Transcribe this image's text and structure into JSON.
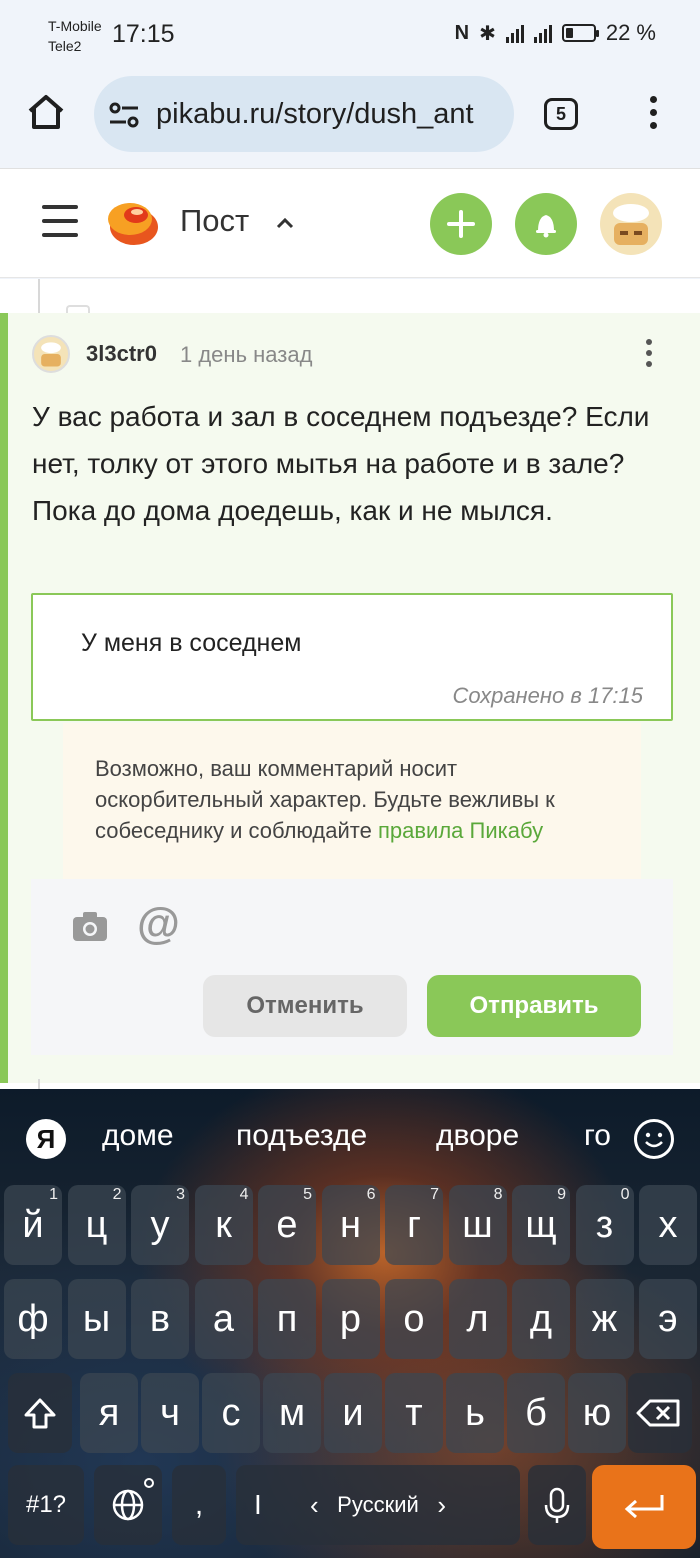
{
  "status": {
    "carrier1": "T-Mobile",
    "carrier2": "Tele2",
    "time": "17:15",
    "battery": "22 %"
  },
  "browser": {
    "url": "pikabu.ru/story/dush_ant",
    "tab_count": "5"
  },
  "header": {
    "title": "Пост"
  },
  "comment": {
    "author": "3l3ctr0",
    "time": "1 день назад",
    "text": "У вас работа и зал в соседнем подъезде? Если нет, толку от этого мытья на работе и в зале? Пока до дома доедешь, как и не мылся."
  },
  "editor": {
    "value": "У меня в соседнем",
    "saved": "Сохранено в 17:15"
  },
  "warning": {
    "text": "Возможно, ваш комментарий носит оскорбительный характер. Будьте вежливы к собеседнику и соблюдайте ",
    "link": "правила Пикабу"
  },
  "toolbar": {
    "at": "@",
    "cancel": "Отменить",
    "send": "Отправить"
  },
  "keyboard": {
    "logo": "Я",
    "suggestions": [
      "доме",
      "подъезде",
      "дворе",
      "го"
    ],
    "row1": [
      "й",
      "ц",
      "у",
      "к",
      "е",
      "н",
      "г",
      "ш",
      "щ",
      "з",
      "х"
    ],
    "row1_hints": [
      "1",
      "2",
      "3",
      "4",
      "5",
      "6",
      "7",
      "8",
      "9",
      "0"
    ],
    "row2": [
      "ф",
      "ы",
      "в",
      "а",
      "п",
      "р",
      "о",
      "л",
      "д",
      "ж",
      "э"
    ],
    "row3": [
      "я",
      "ч",
      "с",
      "м",
      "и",
      "т",
      "ь",
      "б",
      "ю"
    ],
    "symbols": "#1?",
    "comma": ",",
    "language": "Русский",
    "lang_left": "‹",
    "lang_right": "›",
    "accent_color": "#e9731a"
  },
  "colors": {
    "brand_green": "#8ac858",
    "link_green": "#5aa83a"
  }
}
